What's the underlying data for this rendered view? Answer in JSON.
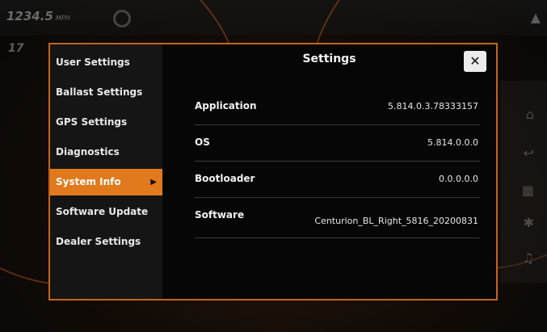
{
  "background": {
    "speed_value": "1234.5",
    "speed_unit": "MPH",
    "depth_value": "17"
  },
  "settings_dialog": {
    "title": "Settings",
    "close_icon": "close-icon",
    "menu": [
      {
        "label": "User Settings",
        "active": false
      },
      {
        "label": "Ballast Settings",
        "active": false
      },
      {
        "label": "GPS Settings",
        "active": false
      },
      {
        "label": "Diagnostics",
        "active": false
      },
      {
        "label": "System Info",
        "active": true
      },
      {
        "label": "Software Update",
        "active": false
      },
      {
        "label": "Dealer Settings",
        "active": false
      }
    ],
    "info": [
      {
        "label": "Application",
        "value": "5.814.0.3.78333157"
      },
      {
        "label": "OS",
        "value": "5.814.0.0.0"
      },
      {
        "label": "Bootloader",
        "value": "0.0.0.0.0"
      },
      {
        "label": "Software",
        "value": "Centurion_BL_Right_5816_20200831"
      }
    ]
  },
  "colors": {
    "accent": "#e07a1c",
    "border": "#c4641e",
    "panel_bg": "#060606",
    "sidebar_bg": "#151515"
  }
}
